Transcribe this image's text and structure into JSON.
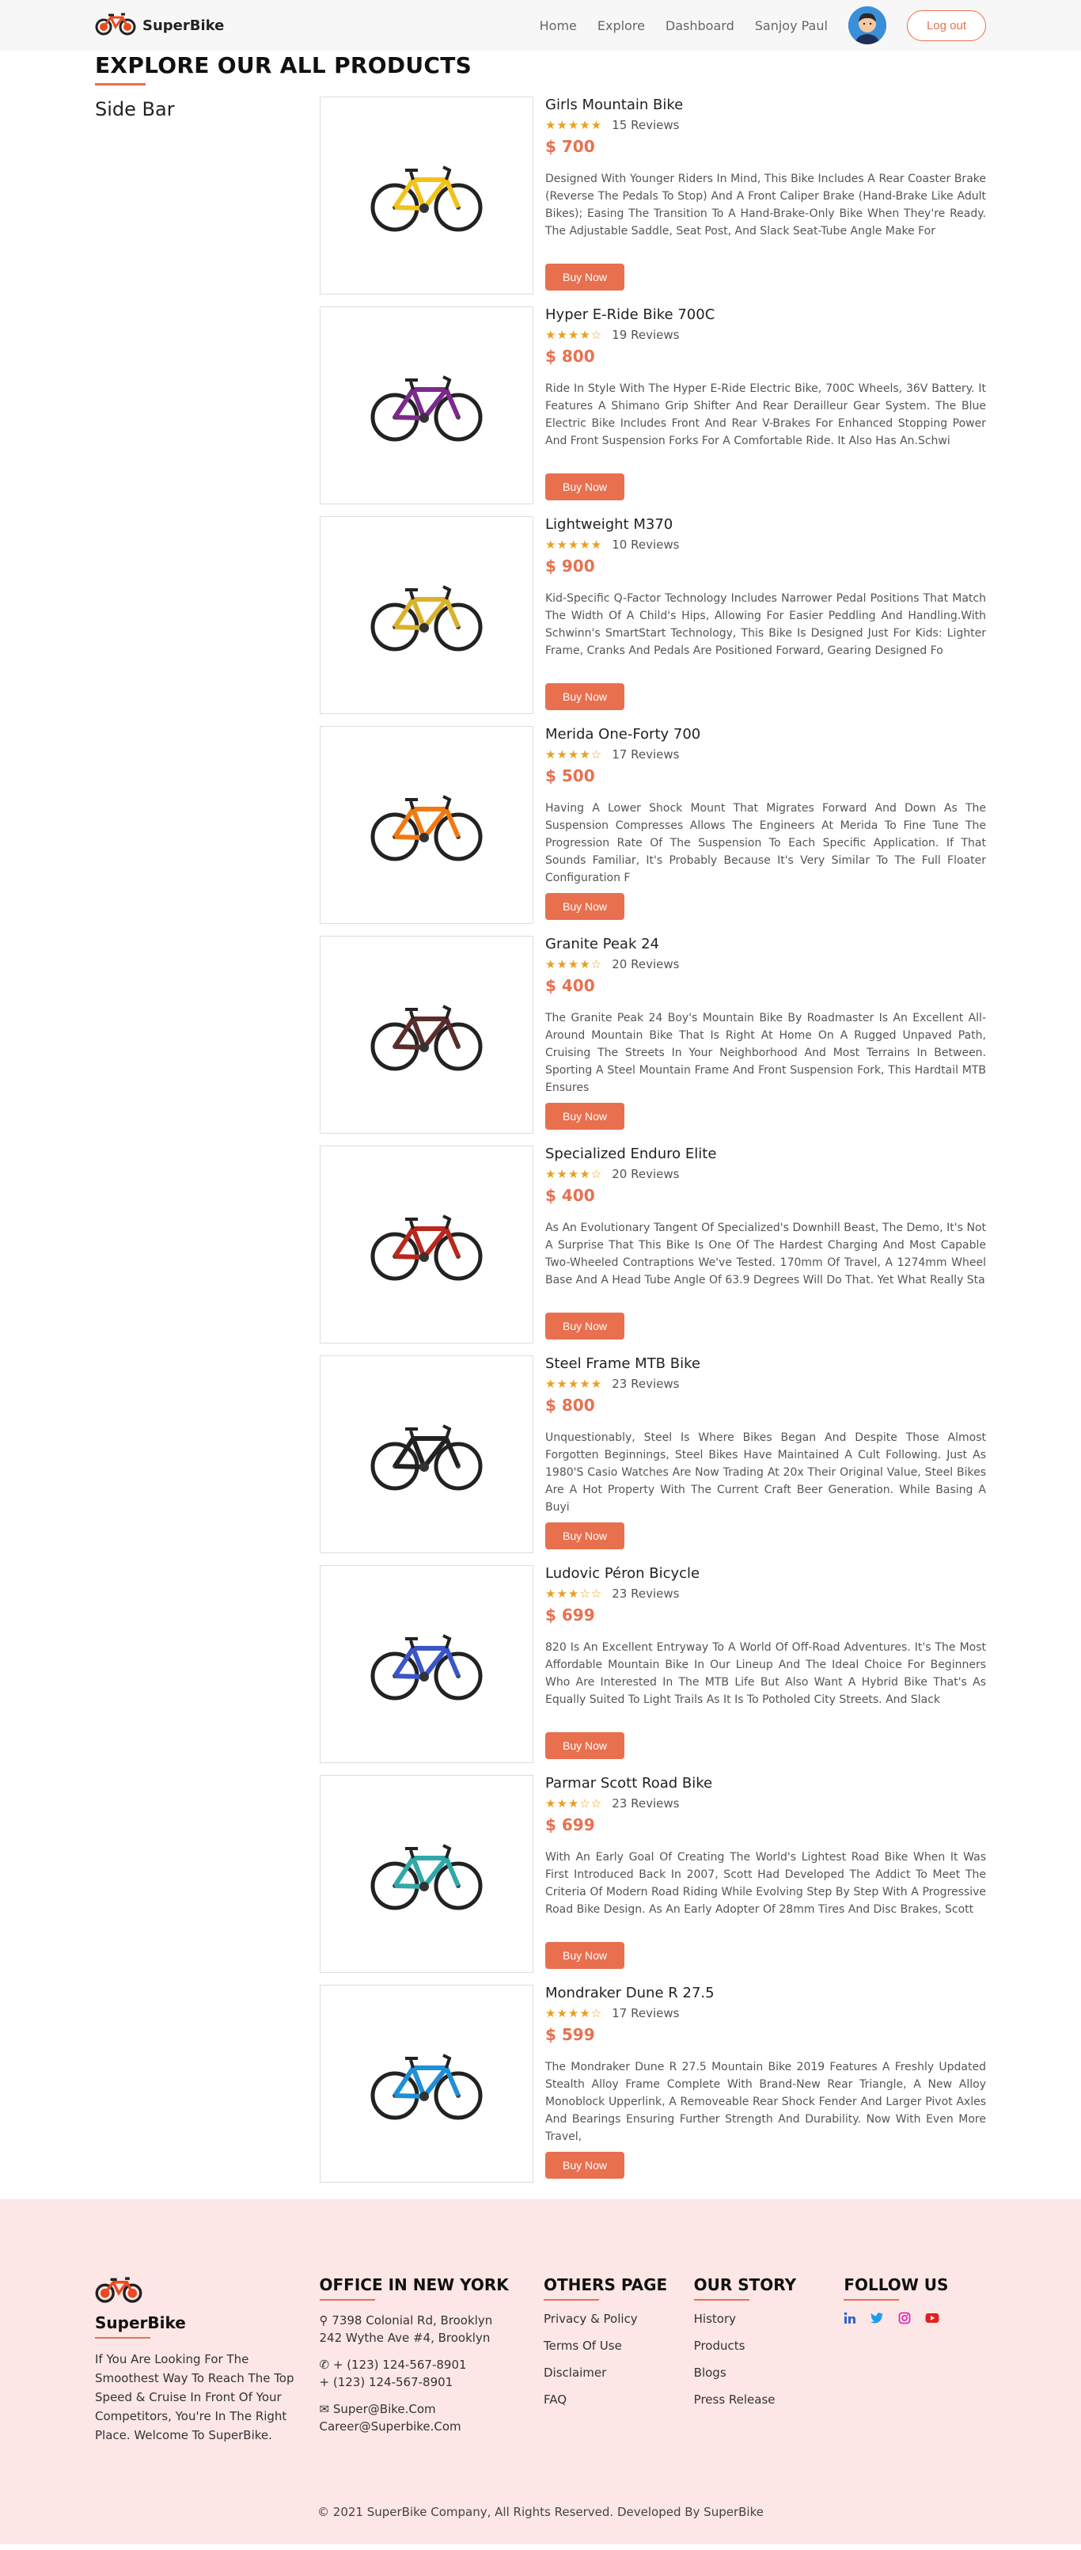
{
  "brand": {
    "name": "SuperBike"
  },
  "nav": {
    "home": "Home",
    "explore": "Explore",
    "dashboard": "Dashboard",
    "user": "Sanjoy Paul",
    "logout": "Log out"
  },
  "page": {
    "title": "EXPLORE OUR ALL PRODUCTS",
    "sidebar": "Side Bar"
  },
  "colors": {
    "accent": "#e8704f",
    "star": "#e8a020",
    "footer_bg": "#fce6e6"
  },
  "products": [
    {
      "name": "Girls Mountain Bike",
      "stars": "★★★★★",
      "reviews": "15 Reviews",
      "price": "$ 700",
      "button": "Buy Now",
      "color": "#f2c21b",
      "desc": "Designed With Younger Riders In Mind, This Bike Includes A Rear Coaster Brake (Reverse The Pedals To Stop) And A Front Caliper Brake (Hand-Brake Like Adult Bikes); Easing The Transition To A Hand-Brake-Only Bike When They're Ready. The Adjustable Saddle, Seat Post, And Slack Seat-Tube Angle Make For"
    },
    {
      "name": "Hyper E-Ride Bike 700C",
      "stars": "★★★★☆",
      "reviews": "19 Reviews",
      "price": "$ 800",
      "button": "Buy Now",
      "color": "#7b2a8c",
      "desc": "Ride In Style With The Hyper E-Ride Electric Bike, 700C Wheels, 36V Battery. It Features A Shimano Grip Shifter And Rear Derailleur Gear System. The Blue Electric Bike Includes Front And Rear V-Brakes For Enhanced Stopping Power And Front Suspension Forks For A Comfortable Ride. It Also Has An.Schwi"
    },
    {
      "name": "Lightweight M370",
      "stars": "★★★★★",
      "reviews": "10 Reviews",
      "price": "$ 900",
      "button": "Buy Now",
      "color": "#d9b22c",
      "desc": "Kid-Specific Q-Factor Technology Includes Narrower Pedal Positions That Match The Width Of A Child's Hips, Allowing For Easier Peddling And Handling.With Schwinn's SmartStart Technology, This Bike Is Designed Just For Kids: Lighter Frame, Cranks And Pedals Are Positioned Forward, Gearing Designed Fo"
    },
    {
      "name": "Merida One-Forty 700",
      "stars": "★★★★☆",
      "reviews": "17 Reviews",
      "price": "$ 500",
      "button": "Buy Now",
      "color": "#f07a10",
      "desc": "Having A Lower Shock Mount That Migrates Forward And Down As The Suspension Compresses Allows The Engineers At Merida To Fine Tune The Progression Rate Of The Suspension To Each Specific Application. If That Sounds Familiar, It's Probably Because It's Very Similar To The Full Floater Configuration F"
    },
    {
      "name": "Granite Peak 24",
      "stars": "★★★★☆",
      "reviews": "20 Reviews",
      "price": "$ 400",
      "button": "Buy Now",
      "color": "#5a2d2d",
      "desc": "The Granite Peak 24 Boy's Mountain Bike By Roadmaster Is An Excellent All-Around Mountain Bike That Is Right At Home On A Rugged Unpaved Path, Cruising The Streets In Your Neighborhood And Most Terrains In Between. Sporting A Steel Mountain Frame And Front Suspension Fork, This Hardtail MTB Ensures"
    },
    {
      "name": "Specialized Enduro Elite",
      "stars": "★★★★☆",
      "reviews": "20 Reviews",
      "price": "$ 400",
      "button": "Buy Now",
      "color": "#b8281e",
      "desc": "As An Evolutionary Tangent Of Specialized's Downhill Beast, The Demo, It's Not A Surprise That This Bike Is One Of The Hardest Charging And Most Capable Two-Wheeled Contraptions We've Tested. 170mm Of Travel, A 1274mm Wheel Base And A Head Tube Angle Of 63.9 Degrees Will Do That. Yet What Really Sta"
    },
    {
      "name": "Steel Frame MTB Bike",
      "stars": "★★★★★",
      "reviews": "23 Reviews",
      "price": "$ 800",
      "button": "Buy Now",
      "color": "#222222",
      "desc": "Unquestionably, Steel Is Where Bikes Began And Despite Those Almost Forgotten Beginnings, Steel Bikes Have Maintained A Cult Following. Just As 1980'S Casio Watches Are Now Trading At 20x Their Original Value, Steel Bikes Are A Hot Property With The Current Craft Beer Generation. While Basing A Buyi"
    },
    {
      "name": "Ludovic Péron Bicycle",
      "stars": "★★★☆☆",
      "reviews": "23 Reviews",
      "price": "$ 699",
      "button": "Buy Now",
      "color": "#3b55c8",
      "desc": "820 Is An Excellent Entryway To A World Of Off-Road Adventures. It's The Most Affordable Mountain Bike In Our Lineup And The Ideal Choice For Beginners Who Are Interested In The MTB Life But Also Want A Hybrid Bike That's As Equally Suited To Light Trails As It Is To Potholed City Streets. And Slack"
    },
    {
      "name": "Parmar Scott Road Bike",
      "stars": "★★★☆☆",
      "reviews": "23 Reviews",
      "price": "$ 699",
      "button": "Buy Now",
      "color": "#2fa8a8",
      "desc": "With An Early Goal Of Creating The World's Lightest Road Bike When It Was First Introduced Back In 2007, Scott Had Developed The Addict To Meet The Criteria Of Modern Road Riding While Evolving Step By Step With A Progressive Road Bike Design. As An Early Adopter Of 28mm Tires And Disc Brakes, Scott"
    },
    {
      "name": "Mondraker Dune R 27.5",
      "stars": "★★★★☆",
      "reviews": "17 Reviews",
      "price": "$ 599",
      "button": "Buy Now",
      "color": "#1e8fd6",
      "desc": "The Mondraker Dune R 27.5 Mountain Bike 2019 Features A Freshly Updated Stealth Alloy Frame Complete With Brand-New Rear Triangle, A New Alloy Monoblock Upperlink, A Removeable Rear Shock Fender And Larger Pivot Axles And Bearings Ensuring Further Strength And Durability. Now With Even More Travel,"
    }
  ],
  "footer": {
    "brand": "SuperBike",
    "about": "If You Are Looking For The Smoothest Way To Reach The Top Speed & Cruise In Front Of Your Competitors, You're In The Right Place. Welcome To SuperBike.",
    "office": {
      "heading": "OFFICE IN NEW YORK",
      "address1": "7398 Colonial Rd, Brooklyn",
      "address2": "242 Wythe Ave #4, Brooklyn",
      "phone1": "+ (123) 124-567-8901",
      "phone2": "+ (123) 124-567-8901",
      "email1": "Super@Bike.Com",
      "email2": "Career@Superbike.Com"
    },
    "others": {
      "heading": "OTHERS PAGE",
      "items": [
        "Privacy & Policy",
        "Terms Of Use",
        "Disclaimer",
        "FAQ"
      ]
    },
    "story": {
      "heading": "OUR STORY",
      "items": [
        "History",
        "Products",
        "Blogs",
        "Press Release"
      ]
    },
    "follow": {
      "heading": "FOLLOW US",
      "icons": [
        "linkedin-icon",
        "twitter-icon",
        "instagram-icon",
        "youtube-icon"
      ]
    },
    "copyright": "© 2021 SuperBike Company, All Rights Reserved. Developed By SuperBike"
  }
}
